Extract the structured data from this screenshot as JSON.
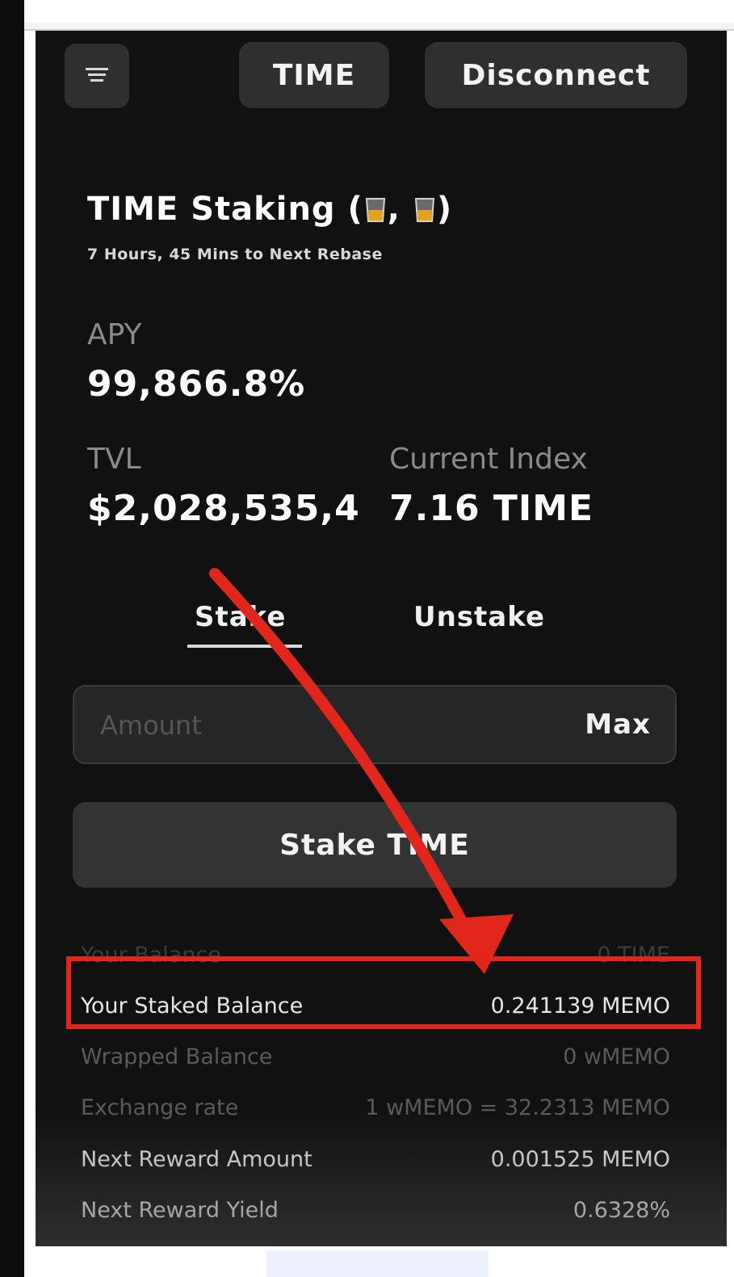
{
  "header": {
    "menu_icon": "filter-menu-icon",
    "token_button": "TIME",
    "disconnect_button": "Disconnect"
  },
  "staking": {
    "title_prefix": "TIME Staking (",
    "title_sep": ", ",
    "title_suffix": ")",
    "title_emoji": "whiskey-glass-emoji",
    "rebase_text": "7 Hours, 45 Mins to Next Rebase",
    "apy_label": "APY",
    "apy_value": "99,866.8%",
    "tvl_label": "TVL",
    "tvl_value": "$2,028,535,4",
    "index_label": "Current Index",
    "index_value": "7.16 TIME"
  },
  "tabs": {
    "stake": "Stake",
    "unstake": "Unstake",
    "active": "stake"
  },
  "form": {
    "amount_placeholder": "Amount",
    "amount_value": "",
    "max_label": "Max",
    "submit_label": "Stake TIME"
  },
  "info_rows": [
    {
      "label": "Your Balance",
      "value": "0 TIME"
    },
    {
      "label": "Your Staked Balance",
      "value": "0.241139 MEMO"
    },
    {
      "label": "Wrapped Balance",
      "value": "0 wMEMO"
    },
    {
      "label": "Exchange rate",
      "value": "1 wMEMO = 32.2313 MEMO"
    },
    {
      "label": "Next Reward Amount",
      "value": "0.001525 MEMO"
    },
    {
      "label": "Next Reward Yield",
      "value": "0.6328%"
    }
  ],
  "colors": {
    "background": "#111111",
    "panel": "#2f2f2f",
    "annotation_red": "#e1261c",
    "text_primary": "#ffffff",
    "text_muted": "#8a8a8a"
  }
}
